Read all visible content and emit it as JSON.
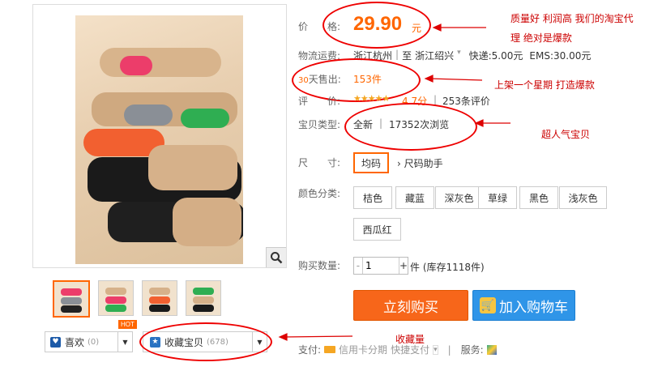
{
  "price": {
    "label": "价　　格:",
    "value": "29.90",
    "unit": "元"
  },
  "shipping": {
    "label": "物流运费:",
    "from": "浙江杭州",
    "sep": "至",
    "to": "浙江绍兴",
    "express": "快递:5.00元",
    "ems": "EMS:30.00元"
  },
  "sales": {
    "days": "30",
    "label": "天售出:",
    "count": "153",
    "unit": "件"
  },
  "rating": {
    "label": "评　　价:",
    "score": "4.7分",
    "count": "253条评价",
    "stars": 4.7
  },
  "condition": {
    "label": "宝贝类型:",
    "type": "全新",
    "views": "17352次浏览"
  },
  "size": {
    "label": "尺　　寸:",
    "selected": "均码",
    "helper": "尺码助手"
  },
  "colors": {
    "label": "颜色分类:",
    "options": [
      "桔色",
      "藏蓝",
      "深灰色",
      "草绿",
      "黑色",
      "浅灰色",
      "西瓜红"
    ]
  },
  "quantity": {
    "label": "购买数量:",
    "value": "1",
    "stock": "件 (库存1118件)"
  },
  "buttons": {
    "buy": "立刻购买",
    "cart": "加入购物车"
  },
  "like": {
    "label": "喜欢",
    "count": "(0)",
    "hot": "HOT"
  },
  "collect": {
    "label": "收藏宝贝",
    "count": "(678)"
  },
  "payment": {
    "label": "支付:",
    "card": "信用卡分期",
    "quick": "快捷支付",
    "service": "服务:"
  },
  "annotations": {
    "a1": "质量好 利润高 我们的淘宝代",
    "a2": "理 绝对是爆款",
    "a3": "上架一个星期 打造爆款",
    "a4": "超人气宝贝",
    "a5": "收藏量"
  },
  "colors_hex": {
    "accent": "#ff6600",
    "annotation": "#cc0000",
    "cart": "#2f95e8",
    "buy": "#f7661a"
  }
}
